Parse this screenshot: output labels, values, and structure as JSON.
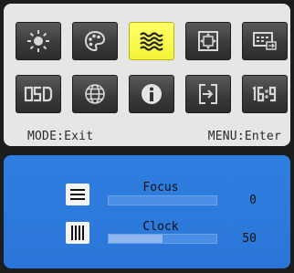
{
  "menu": {
    "tiles": [
      {
        "icon": "brightness-icon",
        "selected": false
      },
      {
        "icon": "color-palette-icon",
        "selected": false
      },
      {
        "icon": "waves-icon",
        "selected": true
      },
      {
        "icon": "image-position-icon",
        "selected": false
      },
      {
        "icon": "input-source-icon",
        "selected": false
      },
      {
        "icon": "osd-icon",
        "selected": false,
        "text": "OSD"
      },
      {
        "icon": "language-globe-icon",
        "selected": false
      },
      {
        "icon": "information-icon",
        "selected": false
      },
      {
        "icon": "reset-icon",
        "selected": false
      },
      {
        "icon": "aspect-ratio-icon",
        "selected": false,
        "text": "16:9"
      }
    ],
    "mode_hint": "MODE:Exit",
    "menu_hint": "MENU:Enter"
  },
  "submenu": {
    "focus": {
      "label": "Focus",
      "value": "0",
      "level": 0
    },
    "clock": {
      "label": "Clock",
      "value": "50",
      "level": 0.5
    }
  },
  "colors": {
    "selected_tile": "#f4f43a",
    "submenu_background": "#2f7fe0"
  }
}
